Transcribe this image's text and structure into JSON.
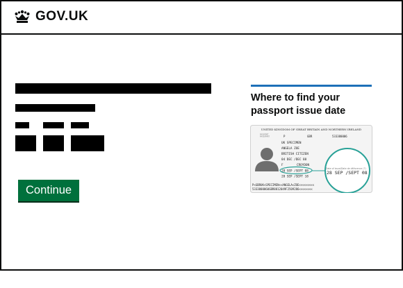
{
  "header": {
    "logo_icon": "crown-icon",
    "logo_text": "GOV.UK"
  },
  "form": {
    "continue_label": "Continue"
  },
  "sidebar": {
    "accent_color": "#1d70b8",
    "title": "Where to find your passport issue date"
  },
  "passport_image": {
    "country": "UNITED KINGDOM OF GREAT BRITAIN AND NORTHERN IRELAND",
    "type": "P",
    "code": "GBR",
    "number": "533380006",
    "surname": "UK SPECIMEN",
    "given_names": "ANGELA ZOE",
    "nationality": "BRITISH CITIZEN",
    "dob": "04 DEC /DEC 88",
    "sex": "F",
    "place_of_birth": "CROYDON",
    "issue_date": "28 SEP /SEPT 08",
    "expiry_date": "28 SEP /SEPT 18",
    "mrz_line1": "P<GBRUK<SPECIMEN<<ANGELA<ZOE<<<<<<<<<",
    "mrz_line2": "5333800060GBR8812049F2509286<<<<<<<<",
    "zoom_label": "Date of issue/Date de délivrance (7)",
    "zoom_value": "28 SEP /SEPT 08"
  }
}
